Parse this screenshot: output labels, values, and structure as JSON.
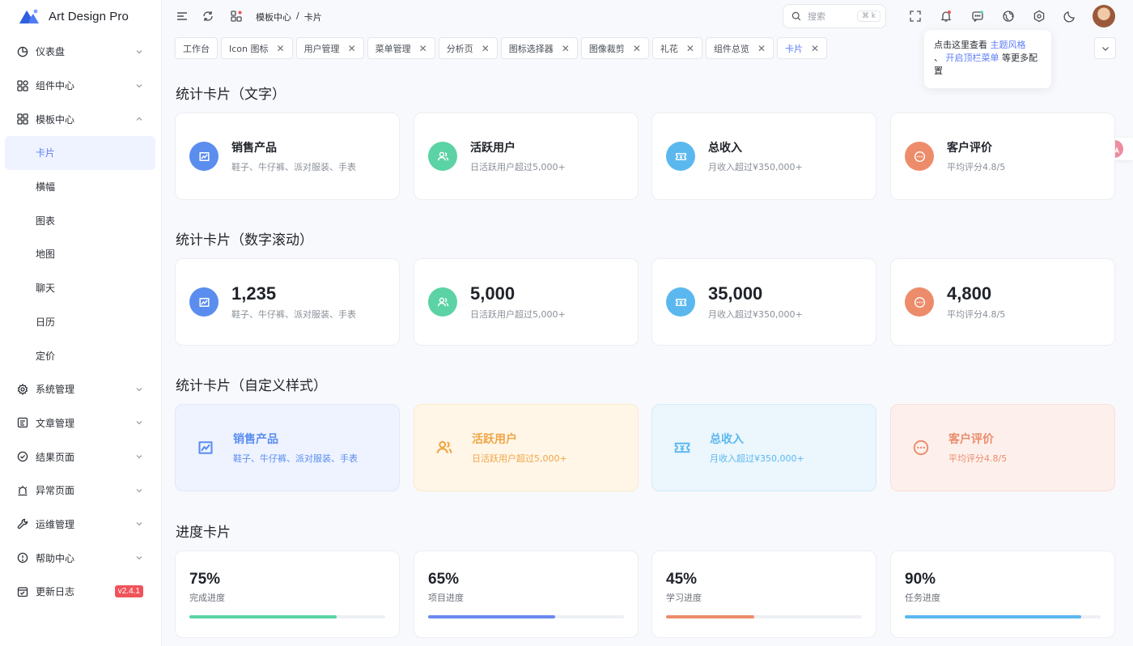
{
  "app": {
    "title": "Art Design Pro"
  },
  "sidebar": {
    "items": [
      {
        "label": "仪表盘",
        "icon": "dashboard-icon"
      },
      {
        "label": "组件中心",
        "icon": "components-icon"
      },
      {
        "label": "模板中心",
        "icon": "template-icon",
        "expanded": true
      },
      {
        "label": "系统管理",
        "icon": "gear-icon"
      },
      {
        "label": "文章管理",
        "icon": "article-icon"
      },
      {
        "label": "结果页面",
        "icon": "check-circle-icon"
      },
      {
        "label": "异常页面",
        "icon": "alarm-icon"
      },
      {
        "label": "运维管理",
        "icon": "wrench-icon"
      },
      {
        "label": "帮助中心",
        "icon": "help-icon"
      },
      {
        "label": "更新日志",
        "icon": "changelog-icon",
        "badge": "v2.4.1"
      }
    ],
    "sub_items": [
      "卡片",
      "横幅",
      "图表",
      "地图",
      "聊天",
      "日历",
      "定价"
    ],
    "active_sub": "卡片"
  },
  "header": {
    "breadcrumb": [
      "模板中心",
      "/",
      "卡片"
    ],
    "search_placeholder": "搜索",
    "search_shortcut": "⌘ k"
  },
  "tabs": [
    "工作台",
    "Icon 图标",
    "用户管理",
    "菜单管理",
    "分析页",
    "图标选择器",
    "图像裁剪",
    "礼花",
    "组件总览",
    "卡片"
  ],
  "tooltip": {
    "prefix": "点击这里查看",
    "link1": "主题风格",
    "sep": "、",
    "link2": "开启顶栏菜单",
    "suffix": "等更多配置"
  },
  "sections": {
    "text_cards": "统计卡片（文字）",
    "number_cards": "统计卡片（数字滚动）",
    "custom_cards": "统计卡片（自定义样式）",
    "progress_cards": "进度卡片"
  },
  "stat_cards": [
    {
      "title": "销售产品",
      "desc": "鞋子、牛仔裤、派对服装、手表",
      "number": "1,235",
      "color": "#5b8def",
      "icon": "chart-icon",
      "bg": "#eef3ff",
      "border": "#dfe7fb"
    },
    {
      "title": "活跃用户",
      "desc": "日活跃用户超过5,000+",
      "number": "5,000",
      "color": "#5bd3a4",
      "icon": "users-icon",
      "bg": "#fff6e8",
      "border": "#fbe9cc",
      "ctext": "#f0a545"
    },
    {
      "title": "总收入",
      "desc": "月收入超过¥350,000+",
      "number": "35,000",
      "color": "#5bb8ef",
      "icon": "ticket-icon",
      "bg": "#ebf6fd",
      "border": "#d3ebf8",
      "ctext": "#5bb8ef"
    },
    {
      "title": "客户评价",
      "desc": "平均评分4.8/5",
      "number": "4,800",
      "color": "#ec8c6b",
      "icon": "more-circle-icon",
      "bg": "#fdf0ec",
      "border": "#f7dfd7",
      "ctext": "#ec8c6b"
    }
  ],
  "progress_cards": [
    {
      "value": "75%",
      "label": "完成进度",
      "fraction": 0.75,
      "color": "#5bd3a4"
    },
    {
      "value": "65%",
      "label": "项目进度",
      "fraction": 0.65,
      "color": "#6a8af0"
    },
    {
      "value": "45%",
      "label": "学习进度",
      "fraction": 0.45,
      "color": "#ec8c6b"
    },
    {
      "value": "90%",
      "label": "任务进度",
      "fraction": 0.9,
      "color": "#5bb8ef"
    }
  ]
}
